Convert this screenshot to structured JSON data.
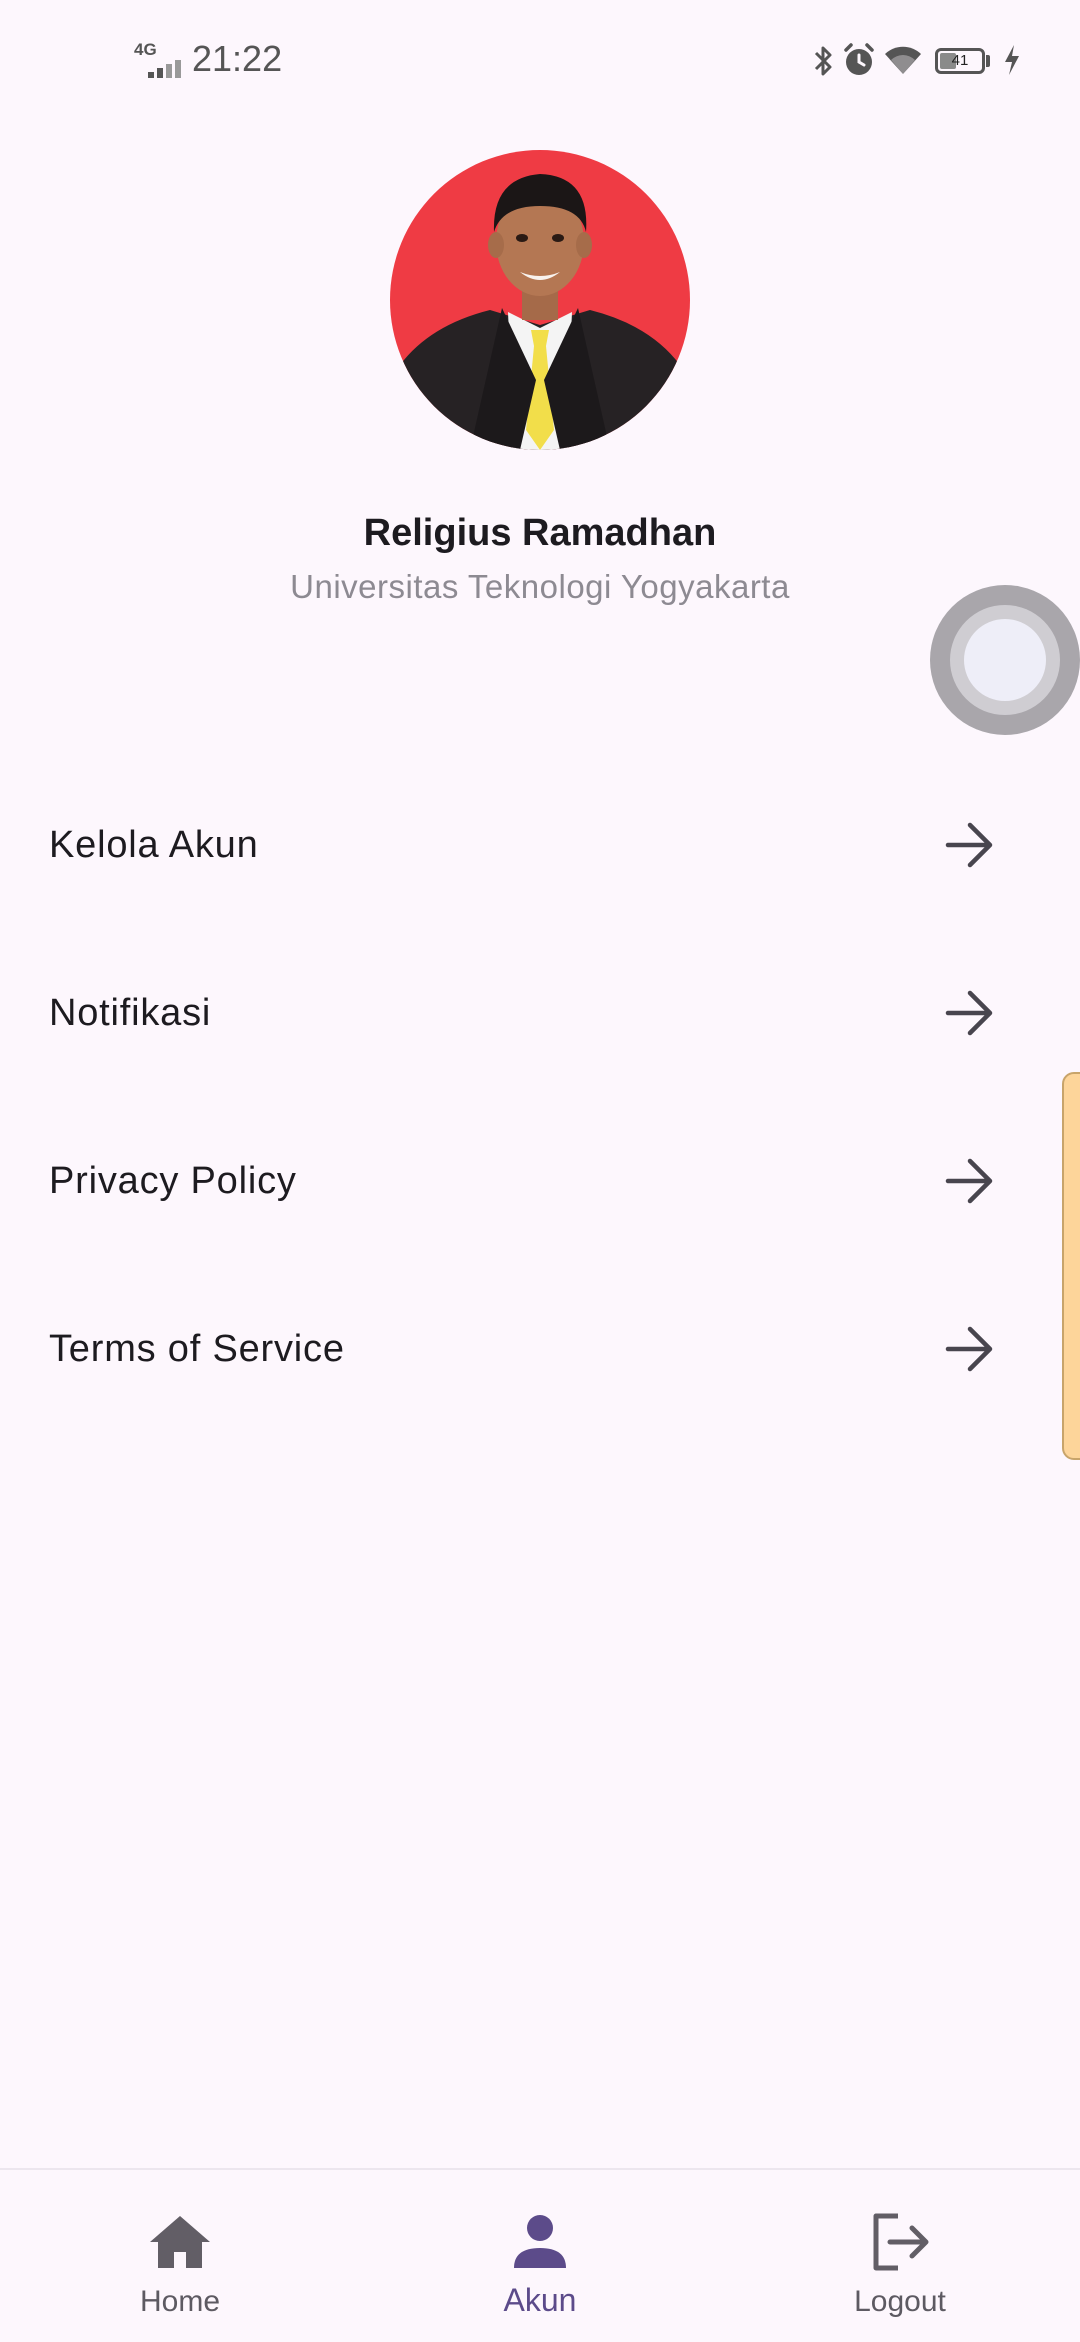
{
  "status_bar": {
    "network": "4G",
    "time": "21:22",
    "battery": "41",
    "battery_level": 0.41
  },
  "profile": {
    "name": "Religius Ramadhan",
    "organization": "Universitas Teknologi Yogyakarta",
    "avatar_icon": "profile-photo"
  },
  "menu": {
    "items": [
      {
        "label": "Kelola Akun",
        "icon": "arrow-right-icon"
      },
      {
        "label": "Notifikasi",
        "icon": "arrow-right-icon"
      },
      {
        "label": "Privacy Policy",
        "icon": "arrow-right-icon"
      },
      {
        "label": "Terms of Service",
        "icon": "arrow-right-icon"
      }
    ]
  },
  "bottom_nav": {
    "items": [
      {
        "label": "Home",
        "icon": "home-icon",
        "active": false
      },
      {
        "label": "Akun",
        "icon": "person-icon",
        "active": true
      },
      {
        "label": "Logout",
        "icon": "logout-icon",
        "active": false
      }
    ]
  },
  "colors": {
    "background": "#fdf7fd",
    "accent": "#5c4b8a",
    "text_primary": "#1d1b20",
    "text_secondary": "#8d8a92",
    "avatar_background": "#ef3b44"
  }
}
